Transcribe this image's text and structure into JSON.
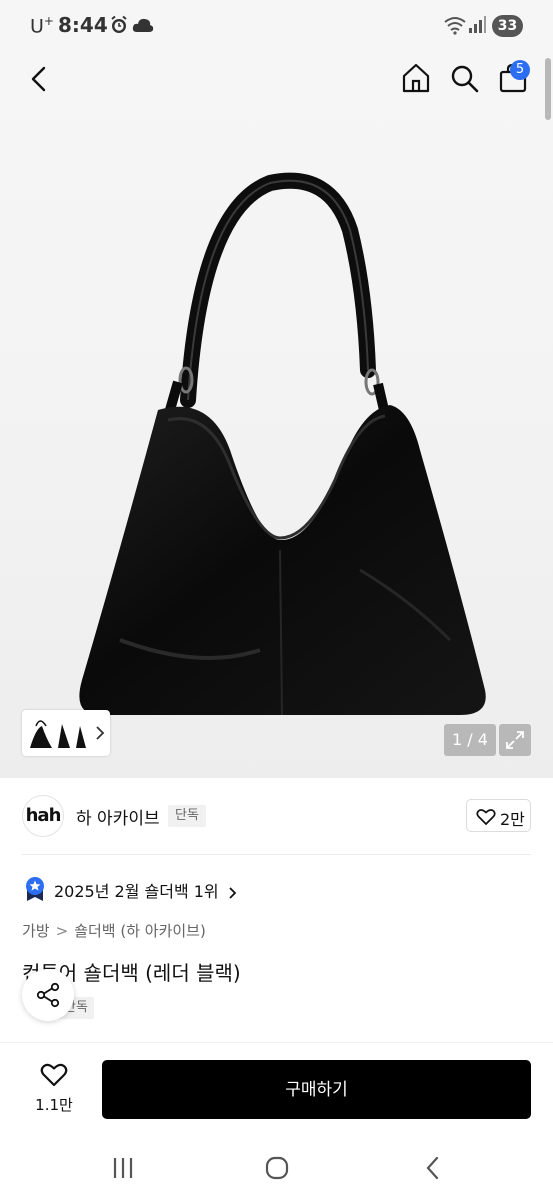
{
  "status_bar": {
    "carrier": "U",
    "carrier_sup": "+",
    "time": "8:44",
    "battery": "33"
  },
  "header": {
    "cart_count": "5"
  },
  "gallery": {
    "counter": "1 / 4"
  },
  "brand": {
    "logo_text": "hah",
    "name": "하 아카이브",
    "tag": "단독",
    "likes": "2만"
  },
  "ranking": {
    "text": "2025년 2월 숄더백 1위"
  },
  "breadcrumb": {
    "level1": "가방",
    "level2": "숄더백 (하 아카이브)"
  },
  "product": {
    "title": "컨투어 숄더백 (레더 블랙)",
    "tag": "단독"
  },
  "bottom": {
    "wish_count": "1.1만",
    "buy_label": "구매하기"
  },
  "colors": {
    "accent": "#2c6ef2",
    "buy_button": "#000000"
  }
}
